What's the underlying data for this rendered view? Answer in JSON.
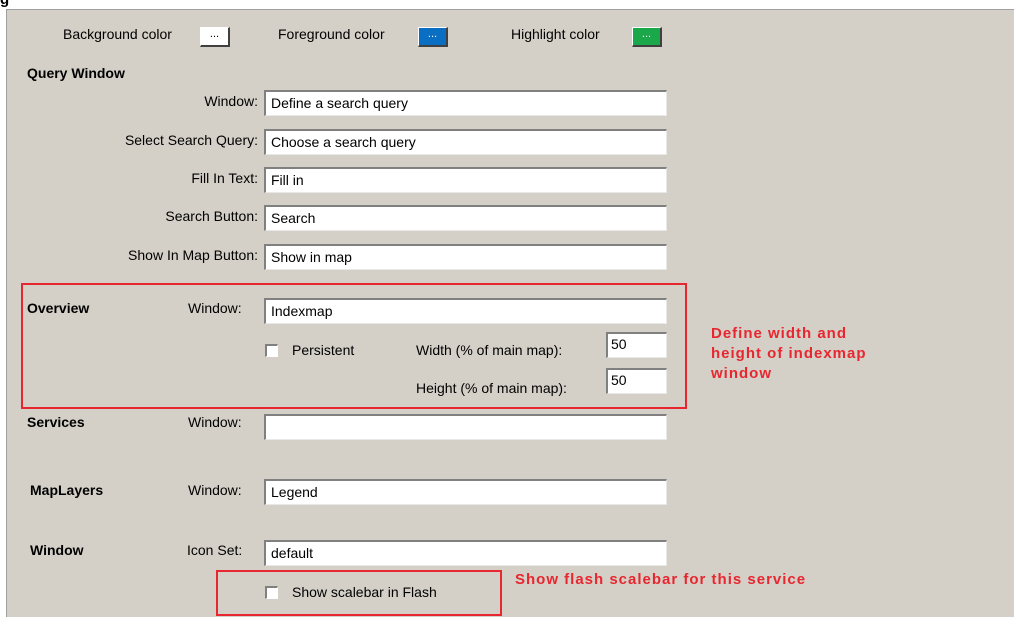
{
  "top_strip": {
    "cut_text": "g"
  },
  "colors_row": {
    "background_label": "Background color",
    "background_button": "...",
    "background_color": "#ffffff",
    "foreground_label": "Foreground color",
    "foreground_button": "...",
    "foreground_color": "#0a6fc2",
    "highlight_label": "Highlight color",
    "highlight_button": "...",
    "highlight_color": "#1aa84a"
  },
  "query_window": {
    "header": "Query Window",
    "rows": [
      {
        "label": "Window:",
        "value": "Define a search query"
      },
      {
        "label": "Select Search Query:",
        "value": "Choose a search query"
      },
      {
        "label": "Fill In Text:",
        "value": "Fill in"
      },
      {
        "label": "Search Button:",
        "value": "Search"
      },
      {
        "label": "Show In Map Button:",
        "value": "Show in map"
      }
    ]
  },
  "overview": {
    "header": "Overview",
    "window_label": "Window:",
    "window_value": "Indexmap",
    "persistent_label": "Persistent",
    "persistent_checked": false,
    "width_label": "Width (% of main map):",
    "width_value": "50",
    "height_label": "Height (% of main map):",
    "height_value": "50"
  },
  "services": {
    "header": "Services",
    "window_label": "Window:",
    "window_value": ""
  },
  "maplayers": {
    "header": "MapLayers",
    "window_label": "Window:",
    "window_value": "Legend"
  },
  "window_section": {
    "header": "Window",
    "iconset_label": "Icon Set:",
    "iconset_value": "default",
    "scalebar_label": "Show scalebar in Flash",
    "scalebar_checked": false
  },
  "annotations": {
    "overview_note_lines": [
      "Define width and",
      "height of indexmap",
      "window"
    ],
    "scalebar_note": "Show flash scalebar for this service",
    "color": "#e8262f"
  }
}
